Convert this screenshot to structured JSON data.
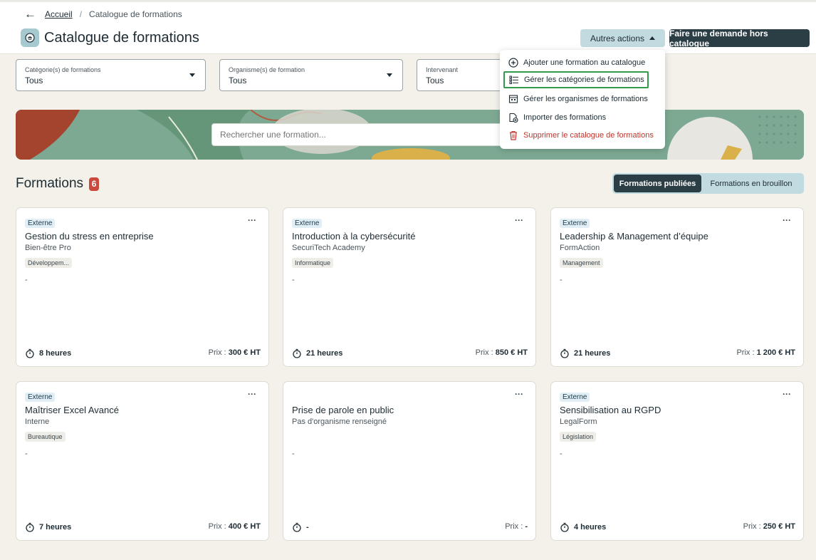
{
  "breadcrumb": {
    "back": "←",
    "home": "Accueil",
    "current": "Catalogue de formations"
  },
  "header": {
    "title": "Catalogue de formations",
    "actions_label": "Autres actions",
    "request_label": "Faire une demande hors catalogue"
  },
  "filters": [
    {
      "label": "Catégorie(s) de formations",
      "value": "Tous"
    },
    {
      "label": "Organisme(s) de formation",
      "value": "Tous"
    },
    {
      "label": "Intervenant",
      "value": "Tous"
    }
  ],
  "search": {
    "placeholder": "Rechercher une formation..."
  },
  "section": {
    "title": "Formations",
    "count": "6"
  },
  "toggle": {
    "published": "Formations publiées",
    "draft": "Formations en brouillon"
  },
  "menu": [
    {
      "label": "Ajouter une formation au catalogue",
      "icon": "plus-circle-icon"
    },
    {
      "label": "Gérer les catégories de formations",
      "icon": "list-icon"
    },
    {
      "label": "Gérer les organismes de formations",
      "icon": "building-icon"
    },
    {
      "label": "Importer des formations",
      "icon": "import-icon"
    },
    {
      "label": "Supprimer le catalogue de formations",
      "icon": "trash-icon"
    }
  ],
  "cards": [
    {
      "badge": "Externe",
      "title": "Gestion du stress en entreprise",
      "org": "Bien-être Pro",
      "tag": "Développem...",
      "desc": "-",
      "duration": "8 heures",
      "price_label": "Prix : ",
      "price": "300 € HT"
    },
    {
      "badge": "Externe",
      "title": "Introduction à la cybersécurité",
      "org": "SecuriTech Academy",
      "tag": "Informatique",
      "desc": "-",
      "duration": "21 heures",
      "price_label": "Prix : ",
      "price": "850 € HT"
    },
    {
      "badge": "Externe",
      "title": "Leadership & Management d’équipe",
      "org": "FormAction",
      "tag": "Management",
      "desc": "-",
      "duration": "21 heures",
      "price_label": "Prix : ",
      "price": "1 200 € HT"
    },
    {
      "badge": "Externe",
      "title": "Maîtriser Excel Avancé",
      "org": "Interne",
      "tag": "Bureautique",
      "desc": "-",
      "duration": "7 heures",
      "price_label": "Prix : ",
      "price": "400 € HT"
    },
    {
      "badge": "",
      "title": "Prise de parole en public",
      "org": "Pas d'organisme renseigné",
      "tag": "",
      "desc": "-",
      "duration": "-",
      "price_label": "Prix : ",
      "price": "-"
    },
    {
      "badge": "Externe",
      "title": "Sensibilisation au RGPD",
      "org": "LegalForm",
      "tag": "Législation",
      "desc": "-",
      "duration": "4 heures",
      "price_label": "Prix : ",
      "price": "250 € HT"
    }
  ],
  "more_glyph": "···",
  "colors": {
    "primary": "#2b3e46",
    "accent": "#c2dbe1",
    "danger": "#c0332b",
    "badge": "#c94a3c",
    "highlight": "#2e9a4a"
  }
}
